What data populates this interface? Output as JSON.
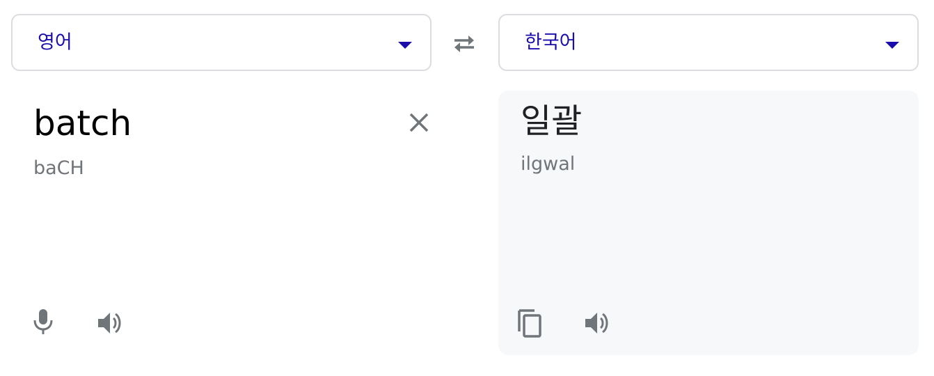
{
  "source_language": {
    "label": "영어"
  },
  "target_language": {
    "label": "한국어"
  },
  "source": {
    "text": "batch",
    "transliteration": "baCH"
  },
  "target": {
    "text": "일괄",
    "transliteration": "ilgwal"
  },
  "icons": {
    "caret": "caret-down-icon",
    "swap": "swap-icon",
    "clear": "close-icon",
    "microphone": "microphone-icon",
    "speaker": "speaker-icon",
    "copy": "copy-icon"
  },
  "colors": {
    "accent": "#1a0dab",
    "icon": "#70757a",
    "border": "#dadce0",
    "result_background": "#f7f8fa"
  }
}
